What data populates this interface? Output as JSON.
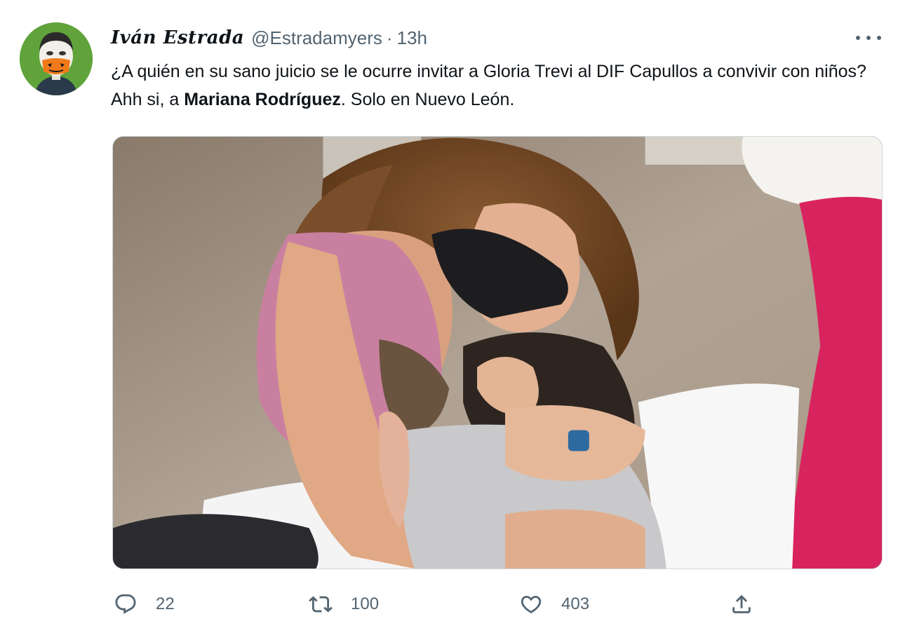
{
  "tweet": {
    "display_name": "Iván Estrada",
    "handle": "@Estradamyers",
    "separator": "·",
    "time": "13h",
    "text_part1": "¿A quién en su sano juicio se le ocurre invitar a Gloria Trevi al DIF Capullos a convivir con niños? Ahh si, a ",
    "text_bold": "Mariana Rodríguez",
    "text_part2": ". Solo en Nuevo León."
  },
  "actions": {
    "reply_count": "22",
    "retweet_count": "100",
    "like_count": "403"
  },
  "icons": {
    "more": "more-icon",
    "reply": "reply-icon",
    "retweet": "retweet-icon",
    "like": "heart-icon",
    "share": "share-icon"
  },
  "colors": {
    "text_primary": "#0f1419",
    "text_secondary": "#536471",
    "border": "#cfd9de",
    "avatar_bg": "#5fa33a"
  }
}
